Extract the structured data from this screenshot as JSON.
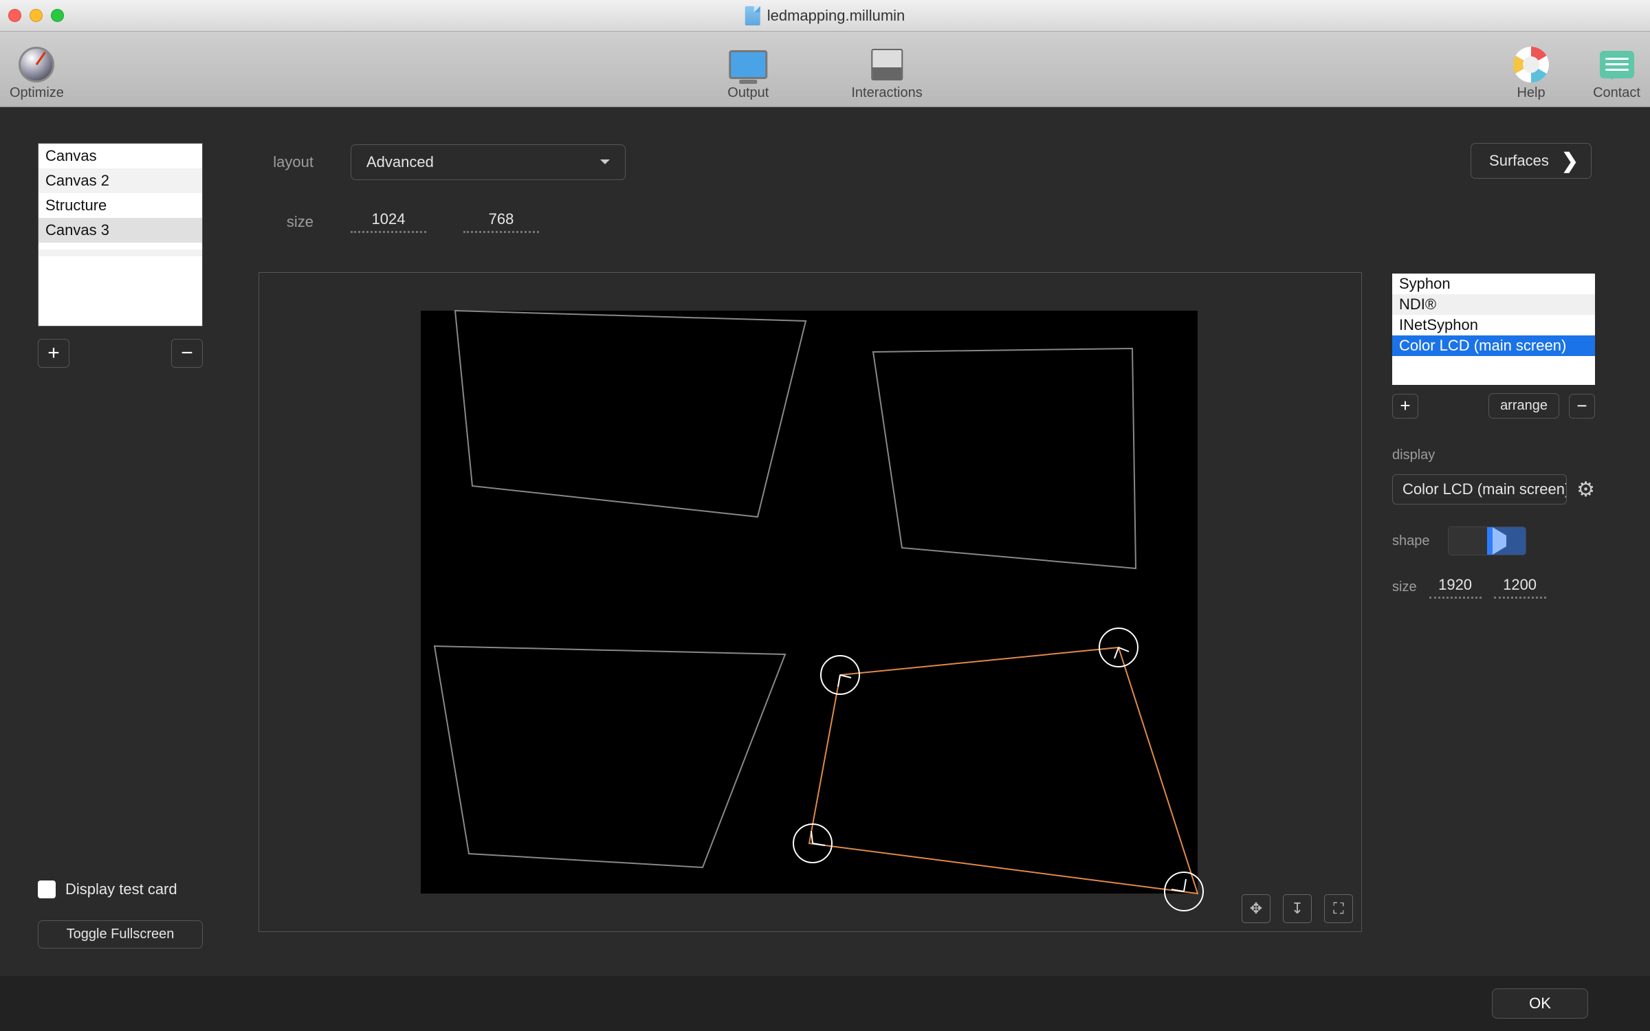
{
  "window": {
    "document_title": "ledmapping.millumin"
  },
  "toolbar": {
    "optimize": "Optimize",
    "output": "Output",
    "interactions": "Interactions",
    "help": "Help",
    "contact": "Contact"
  },
  "sidebar": {
    "canvas_list": [
      "Canvas",
      "Canvas 2",
      "Structure",
      "Canvas 3"
    ],
    "selected_index": 3,
    "add_label": "+",
    "remove_label": "−",
    "display_test_card_label": "Display test card",
    "display_test_card_checked": false,
    "toggle_fullscreen_label": "Toggle Fullscreen"
  },
  "settings": {
    "layout_label": "layout",
    "layout_value": "Advanced",
    "size_label": "size",
    "width": "1024",
    "height": "768"
  },
  "surfaces_button": "Surfaces",
  "outputs": {
    "list": [
      "Syphon",
      "NDI®",
      "INetSyphon",
      "Color LCD (main screen)"
    ],
    "highlight_index": 3,
    "add_label": "+",
    "arrange_label": "arrange",
    "remove_label": "−",
    "display_label": "display",
    "display_value": "Color LCD (main screen)",
    "shape_label": "shape",
    "size_label": "size",
    "out_width": "1920",
    "out_height": "1200"
  },
  "footer": {
    "ok_label": "OK"
  },
  "canvas_tools": {
    "move": "✥",
    "align": "↧",
    "fullscreen": "⛶"
  }
}
